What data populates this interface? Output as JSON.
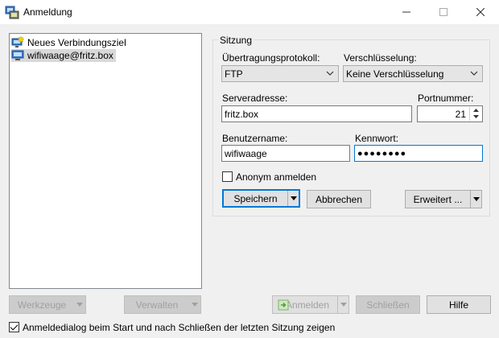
{
  "window": {
    "title": "Anmeldung",
    "icon": "winscp-app-icon",
    "controls": {
      "minimize": "minimize-icon",
      "maximize": "maximize-icon",
      "close": "close-icon"
    }
  },
  "site_tree": {
    "items": [
      {
        "label": "Neues Verbindungsziel",
        "icon": "new-site-computer-icon",
        "selected": false
      },
      {
        "label": "wifiwaage@fritz.box",
        "icon": "site-computer-icon",
        "selected": true
      }
    ]
  },
  "session": {
    "legend": "Sitzung",
    "protocol_label": "Übertragungsprotokoll:",
    "protocol_value": "FTP",
    "encryption_label": "Verschlüsselung:",
    "encryption_value": "Keine Verschlüsselung",
    "host_label": "Serveradresse:",
    "host_value": "fritz.box",
    "port_label": "Portnummer:",
    "port_value": "21",
    "user_label": "Benutzername:",
    "user_value": "wifiwaage",
    "password_label": "Kennwort:",
    "password_value": "●●●●●●●●",
    "anonymous_label": "Anonym anmelden",
    "anonymous_checked": false,
    "save_label": "Speichern",
    "cancel_label": "Abbrechen",
    "advanced_label": "Erweitert ..."
  },
  "bottom": {
    "tools_label": "Werkzeuge",
    "manage_label": "Verwalten",
    "login_label": "Anmelden",
    "close_label": "Schließen",
    "help_label": "Hilfe",
    "show_on_startup_label": "Anmeldedialog beim Start und nach Schließen der letzten Sitzung zeigen",
    "show_on_startup_checked": true
  },
  "colors": {
    "accent": "#0078d7",
    "selection": "#d9d9d9",
    "window_bg": "#f0f0f0"
  }
}
